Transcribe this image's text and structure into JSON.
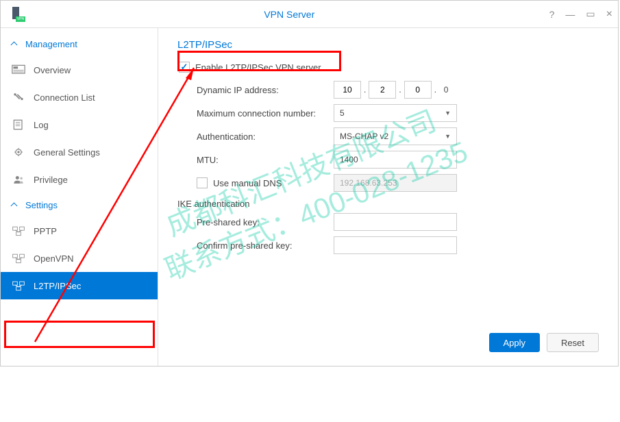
{
  "window": {
    "title": "VPN Server"
  },
  "sidebar": {
    "sections": {
      "management": {
        "label": "Management"
      },
      "settings": {
        "label": "Settings"
      }
    },
    "items": {
      "overview": "Overview",
      "connection_list": "Connection List",
      "log": "Log",
      "general_settings": "General Settings",
      "privilege": "Privilege",
      "pptp": "PPTP",
      "openvpn": "OpenVPN",
      "l2tp": "L2TP/IPSec"
    }
  },
  "page": {
    "title": "L2TP/IPSec",
    "enable_label": "Enable L2TP/IPSec VPN server",
    "enable_checked": true,
    "dynamic_ip_label": "Dynamic IP address:",
    "dynamic_ip": {
      "a": "10",
      "b": "2",
      "c": "0",
      "d": "0"
    },
    "max_conn_label": "Maximum connection number:",
    "max_conn_value": "5",
    "auth_label": "Authentication:",
    "auth_value": "MS-CHAP v2",
    "mtu_label": "MTU:",
    "mtu_value": "1400",
    "manual_dns_label": "Use manual DNS",
    "manual_dns_checked": false,
    "manual_dns_value": "192.168.63.253",
    "ike_label": "IKE authentication",
    "psk_label": "Pre-shared key:",
    "psk_confirm_label": "Confirm pre-shared key:"
  },
  "footer": {
    "apply": "Apply",
    "reset": "Reset"
  },
  "watermark": {
    "line1": "成都科汇科技有限公司",
    "line2": "联系方式：400-028-1235"
  }
}
